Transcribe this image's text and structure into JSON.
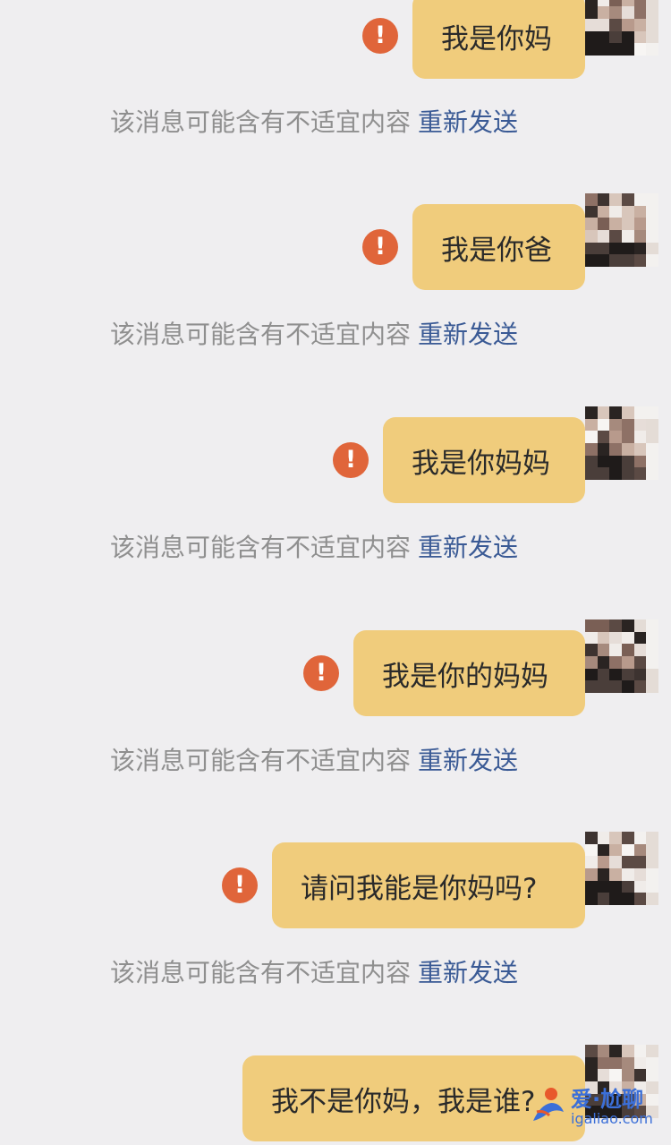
{
  "messages": [
    {
      "text": "我是你妈",
      "status": "send-failed"
    },
    {
      "text": "我是你爸",
      "status": "send-failed"
    },
    {
      "text": "我是你妈妈",
      "status": "send-failed"
    },
    {
      "text": "我是你的妈妈",
      "status": "send-failed"
    },
    {
      "text": "请问我能是你妈吗?",
      "status": "send-failed"
    },
    {
      "text": "我不是你妈，我是谁?",
      "status": "sending"
    }
  ],
  "notice": {
    "text": "该消息可能含有不适宜内容",
    "resend_label": "重新发送"
  },
  "icons": {
    "warning": "exclamation-circle-icon",
    "avatar": "pixelated-avatar"
  },
  "watermark": {
    "brand": "爱·尬聊",
    "url": "igaliao.com"
  },
  "colors": {
    "background": "#efeef0",
    "bubble": "#f0cc7c",
    "warning": "#e0653a",
    "notice_text": "#8f8f8f",
    "resend_link": "#3a5a95",
    "watermark": "#3b6fd8"
  }
}
